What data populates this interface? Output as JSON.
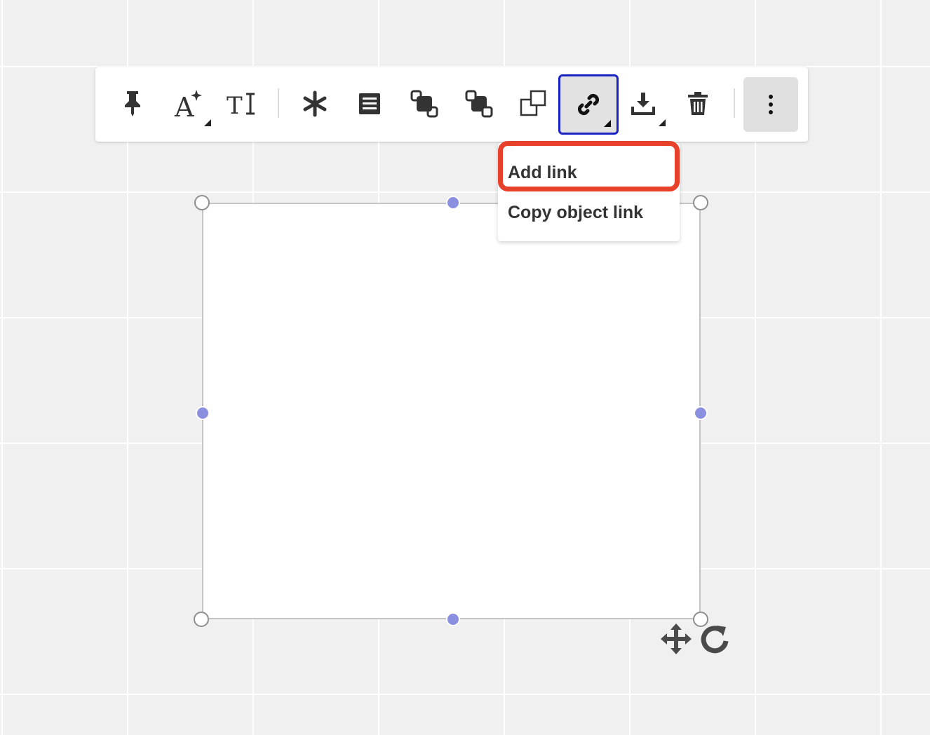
{
  "toolbar": {
    "buttons": [
      {
        "name": "pin",
        "icon": "pin-icon"
      },
      {
        "name": "text-style",
        "icon": "text-style-icon",
        "has_dropdown": true
      },
      {
        "name": "text-format",
        "icon": "text-format-icon"
      },
      {
        "name": "freeze",
        "icon": "snowflake-icon"
      },
      {
        "name": "notes",
        "icon": "notes-icon"
      },
      {
        "name": "bring-forward",
        "icon": "bring-forward-icon"
      },
      {
        "name": "send-backward",
        "icon": "send-backward-icon"
      },
      {
        "name": "duplicate",
        "icon": "duplicate-icon"
      },
      {
        "name": "link",
        "icon": "link-icon",
        "has_dropdown": true,
        "active": true
      },
      {
        "name": "download",
        "icon": "download-icon",
        "has_dropdown": true
      },
      {
        "name": "delete",
        "icon": "trash-icon"
      },
      {
        "name": "more",
        "icon": "more-vertical-icon"
      }
    ]
  },
  "link_menu": {
    "items": [
      {
        "label": "Add link",
        "highlighted": true
      },
      {
        "label": "Copy object link"
      }
    ]
  },
  "colors": {
    "active_border": "#1a22c4",
    "highlight": "#e8412b",
    "handle_mid": "#8a8fe0",
    "canvas_bg": "#f0f0f0",
    "icon": "#333333"
  },
  "floating_controls": {
    "move_icon": "move-icon",
    "rotate_icon": "rotate-icon"
  }
}
